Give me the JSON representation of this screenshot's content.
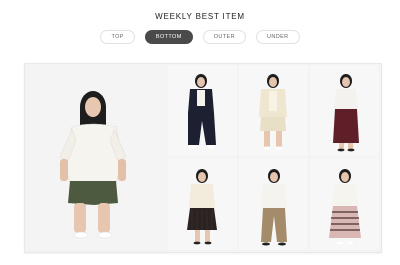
{
  "section": {
    "title": "WEEKLY BEST ITEM"
  },
  "tabs": [
    {
      "label": "TOP",
      "active": false
    },
    {
      "label": "BOTTOM",
      "active": true
    },
    {
      "label": "OUTER",
      "active": false
    },
    {
      "label": "UNDER",
      "active": false
    }
  ],
  "colors": {
    "active_tab": "#4a4a4a",
    "background": "#ffffff",
    "tile": "#f7f7f7"
  },
  "products": [
    {
      "top": "white blouse",
      "bottom": "olive shorts"
    },
    {
      "top": "navy jacket",
      "bottom": "navy wide pants"
    },
    {
      "top": "cream cardigan",
      "bottom": "cream skirt"
    },
    {
      "top": "white tee",
      "bottom": "burgundy skirt"
    },
    {
      "top": "cream blouse",
      "bottom": "black pleated skirt"
    },
    {
      "top": "white knit",
      "bottom": "beige pants"
    },
    {
      "top": "white blouse",
      "bottom": "striped skirt"
    }
  ]
}
